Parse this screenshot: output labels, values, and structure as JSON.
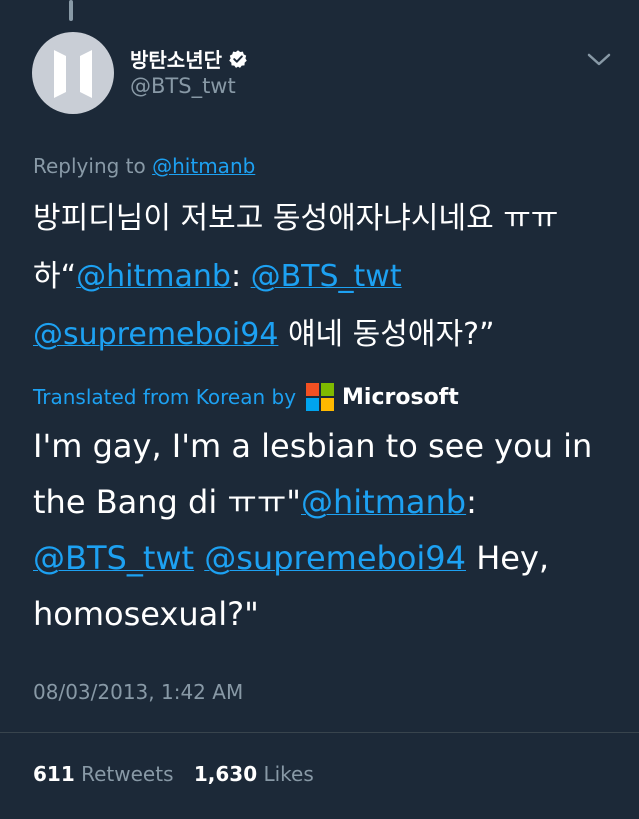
{
  "author": {
    "display_name": "방탄소년단",
    "handle": "@BTS_twt",
    "verified": true
  },
  "reply": {
    "prefix": "Replying to",
    "to": "@hitmanb"
  },
  "tweet": {
    "text_part1": "방피디님이 저보고 동성애자냐시네요 ㅠㅠ하“",
    "mention1": "@hitmanb",
    "colon": ": ",
    "mention2": "@BTS_twt",
    "space": " ",
    "mention3": "@supremeboi94",
    "text_part2": " 얘네 동성애자?”"
  },
  "translation": {
    "label": "Translated from Korean by",
    "provider": "Microsoft",
    "text_part1": "I'm gay, I'm a lesbian to see you in the Bang di ㅠㅠ\"",
    "mention1": "@hitmanb",
    "colon": ": ",
    "mention2": "@BTS_twt",
    "space": " ",
    "mention3": "@supremeboi94",
    "text_part2": " Hey, homosexual?\""
  },
  "timestamp": "08/03/2013, 1:42 AM",
  "stats": {
    "retweets_count": "611",
    "retweets_label": "Retweets",
    "likes_count": "1,630",
    "likes_label": "Likes"
  },
  "icons": {
    "verified": "verified-badge-icon",
    "menu": "chevron-down-icon",
    "provider_logo": "microsoft-logo-icon"
  },
  "colors": {
    "background": "#1c2938",
    "link": "#1da1f2",
    "muted": "#8899a6",
    "text": "#ffffff"
  }
}
